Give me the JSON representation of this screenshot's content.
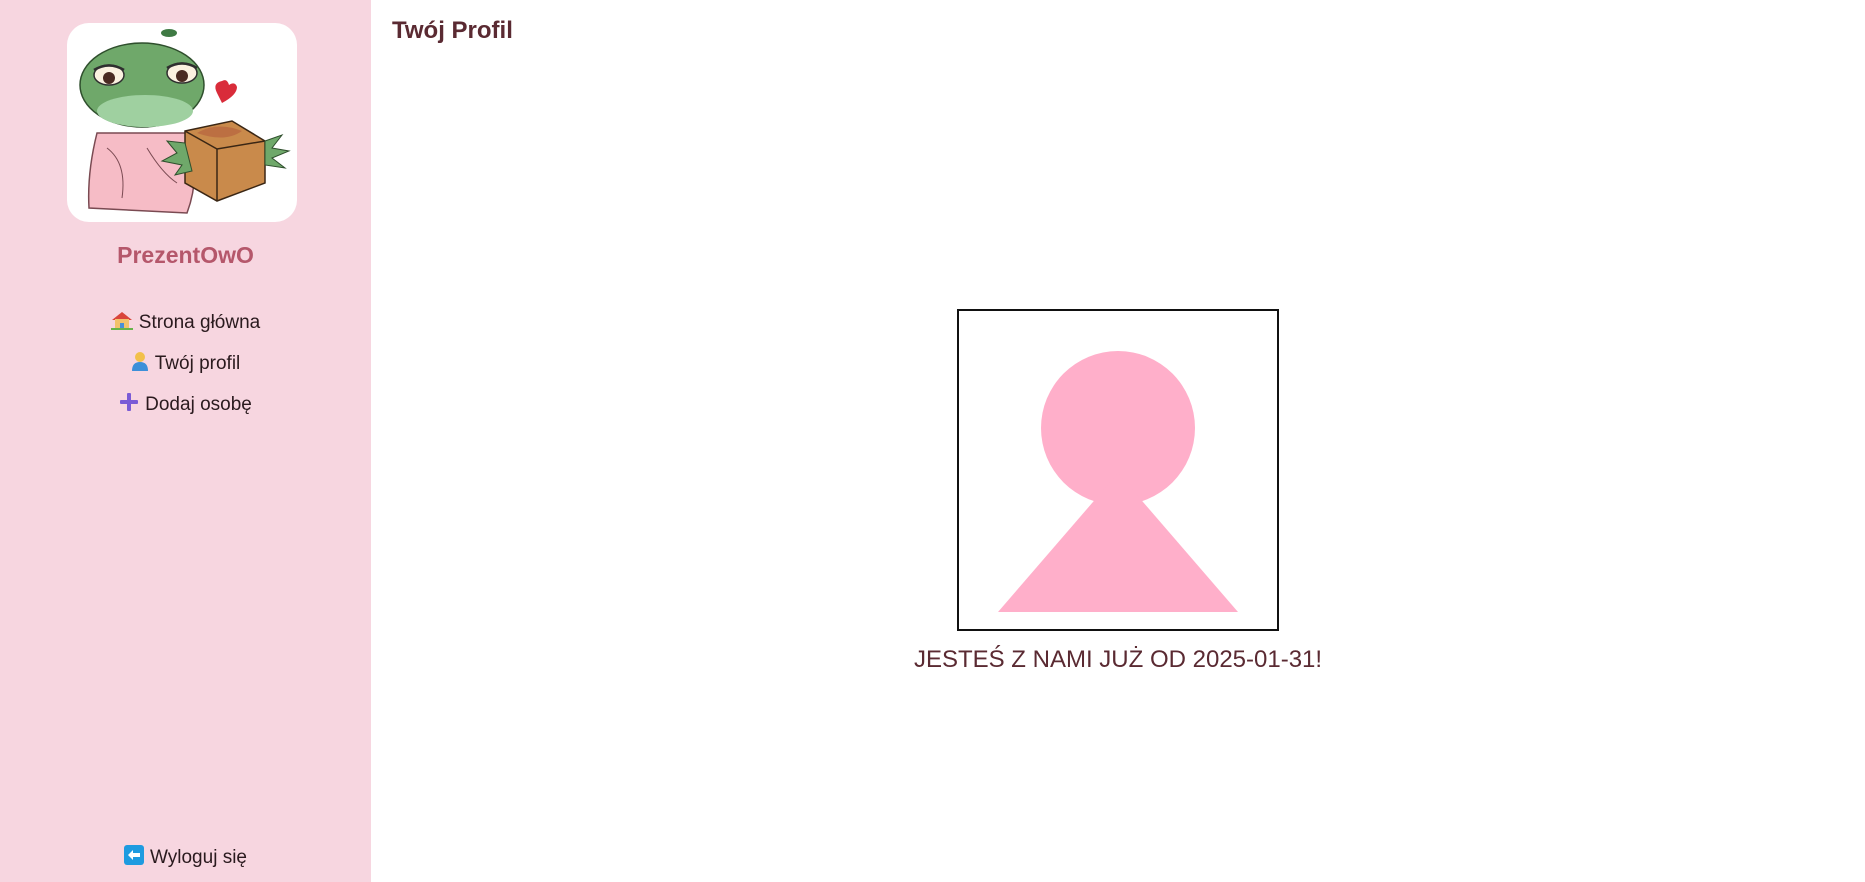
{
  "sidebar": {
    "logo_alt": "PrezentOwO logo - frog holding a gift box",
    "brand": "PrezentOwO",
    "nav": [
      {
        "icon": "house-icon",
        "label": "Strona główna"
      },
      {
        "icon": "person-icon",
        "label": "Twój profil"
      },
      {
        "icon": "plus-icon",
        "label": "Dodaj osobę"
      }
    ],
    "logout": {
      "icon": "arrow-left-icon",
      "label": "Wyloguj się"
    }
  },
  "main": {
    "title": "Twój Profil",
    "member_since_text": "JESTEŚ Z NAMI JUŻ OD 2025-01-31!"
  },
  "colors": {
    "sidebar_bg": "#f7d6e0",
    "brand": "#b5576b",
    "title": "#5a2a32",
    "avatar": "#ffafca",
    "plus": "#7a5bd6",
    "logout_icon": "#1e9be0"
  }
}
